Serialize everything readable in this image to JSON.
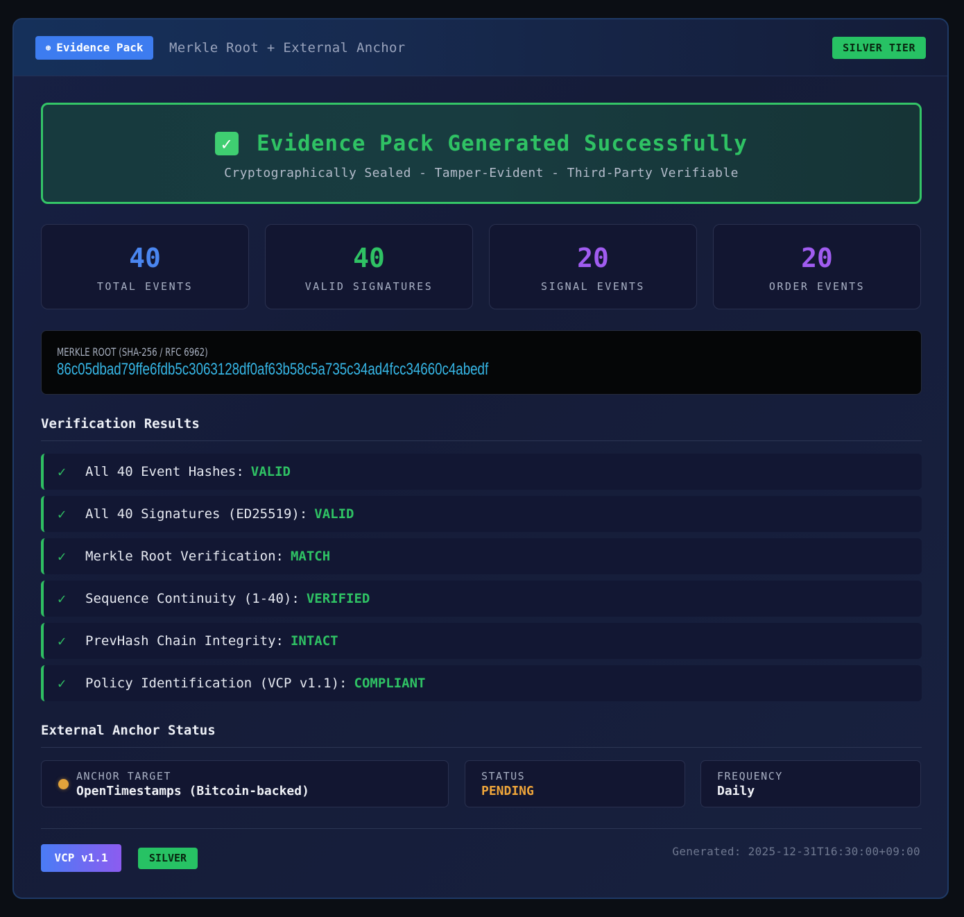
{
  "header": {
    "pack_icon": "⊛",
    "pack_label": "Evidence Pack",
    "subtitle": "Merkle Root + External Anchor",
    "tier": "SILVER TIER"
  },
  "success": {
    "title": "Evidence Pack Generated Successfully",
    "subtitle": "Cryptographically Sealed - Tamper-Evident - Third-Party Verifiable"
  },
  "stats": [
    {
      "value": "40",
      "label": "TOTAL EVENTS",
      "color": "#4a86f0"
    },
    {
      "value": "40",
      "label": "VALID SIGNATURES",
      "color": "#2fc264"
    },
    {
      "value": "20",
      "label": "SIGNAL EVENTS",
      "color": "#a05cf0"
    },
    {
      "value": "20",
      "label": "ORDER EVENTS",
      "color": "#a05cf0"
    }
  ],
  "merkle": {
    "label": "MERKLE ROOT (SHA-256 / RFC 6962)",
    "hash": "86c05dbad79ffe6fdb5c3063128df0af63b58c5a735c34ad4fcc34660c4abedf"
  },
  "verification": {
    "title": "Verification Results",
    "items": [
      {
        "text": "All 40 Event Hashes:",
        "status": "VALID"
      },
      {
        "text": "All 40 Signatures (ED25519):",
        "status": "VALID"
      },
      {
        "text": "Merkle Root Verification:",
        "status": "MATCH"
      },
      {
        "text": "Sequence Continuity (1-40):",
        "status": "VERIFIED"
      },
      {
        "text": "PrevHash Chain Integrity:",
        "status": "INTACT"
      },
      {
        "text": "Policy Identification (VCP v1.1):",
        "status": "COMPLIANT"
      }
    ]
  },
  "anchor": {
    "title": "External Anchor Status",
    "target_label": "ANCHOR TARGET",
    "target_value": "OpenTimestamps (Bitcoin-backed)",
    "status_label": "STATUS",
    "status_value": "PENDING",
    "status_color": "#f0a63a",
    "frequency_label": "FREQUENCY",
    "frequency_value": "Daily"
  },
  "footer": {
    "vcp_badge": "VCP v1.1",
    "silver_badge": "SILVER",
    "generated": "Generated: 2025-12-31T16:30:00+09:00"
  }
}
